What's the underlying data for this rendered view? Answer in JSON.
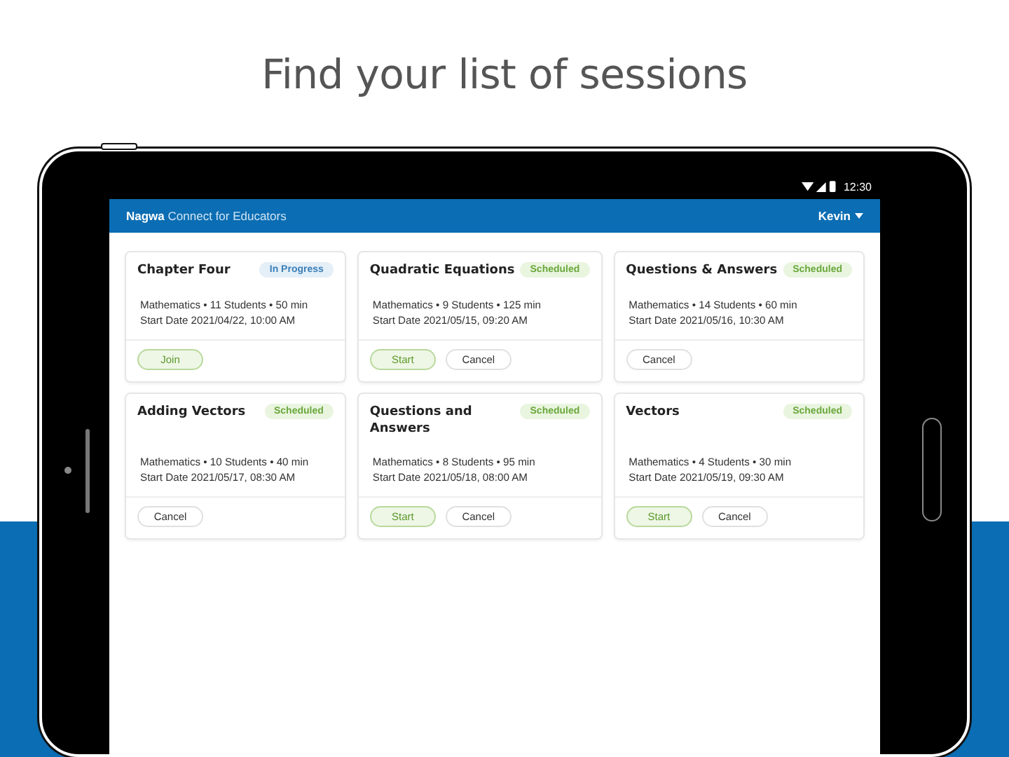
{
  "headline": "Find your list of sessions",
  "status_bar": {
    "time": "12:30"
  },
  "app_bar": {
    "brand": "Nagwa",
    "title": "Connect for Educators",
    "user": "Kevin"
  },
  "sessions": [
    {
      "title": "Chapter Four",
      "status": {
        "label": "In Progress",
        "kind": "in_progress"
      },
      "details": "Mathematics • 11 Students • 50 min",
      "start": "Start Date 2021/04/22, 10:00 AM",
      "buttons": [
        {
          "label": "Join",
          "kind": "primary"
        }
      ]
    },
    {
      "title": "Quadratic Equations",
      "status": {
        "label": "Scheduled",
        "kind": "scheduled"
      },
      "details": "Mathematics • 9 Students • 125 min",
      "start": "Start Date 2021/05/15, 09:20 AM",
      "buttons": [
        {
          "label": "Start",
          "kind": "primary"
        },
        {
          "label": "Cancel",
          "kind": "secondary"
        }
      ]
    },
    {
      "title": "Questions & Answers",
      "status": {
        "label": "Scheduled",
        "kind": "scheduled"
      },
      "details": "Mathematics • 14 Students • 60 min",
      "start": "Start Date 2021/05/16, 10:30 AM",
      "buttons": [
        {
          "label": "Cancel",
          "kind": "secondary"
        }
      ]
    },
    {
      "title": "Adding Vectors",
      "status": {
        "label": "Scheduled",
        "kind": "scheduled"
      },
      "details": "Mathematics • 10 Students • 40 min",
      "start": "Start Date 2021/05/17, 08:30 AM",
      "buttons": [
        {
          "label": "Cancel",
          "kind": "secondary"
        }
      ]
    },
    {
      "title": "Questions and Answers",
      "status": {
        "label": "Scheduled",
        "kind": "scheduled"
      },
      "details": "Mathematics • 8 Students • 95 min",
      "start": "Start Date 2021/05/18, 08:00 AM",
      "buttons": [
        {
          "label": "Start",
          "kind": "primary"
        },
        {
          "label": "Cancel",
          "kind": "secondary"
        }
      ]
    },
    {
      "title": "Vectors",
      "status": {
        "label": "Scheduled",
        "kind": "scheduled"
      },
      "details": "Mathematics • 4 Students • 30 min",
      "start": "Start Date 2021/05/19, 09:30 AM",
      "buttons": [
        {
          "label": "Start",
          "kind": "primary"
        },
        {
          "label": "Cancel",
          "kind": "secondary"
        }
      ]
    }
  ]
}
